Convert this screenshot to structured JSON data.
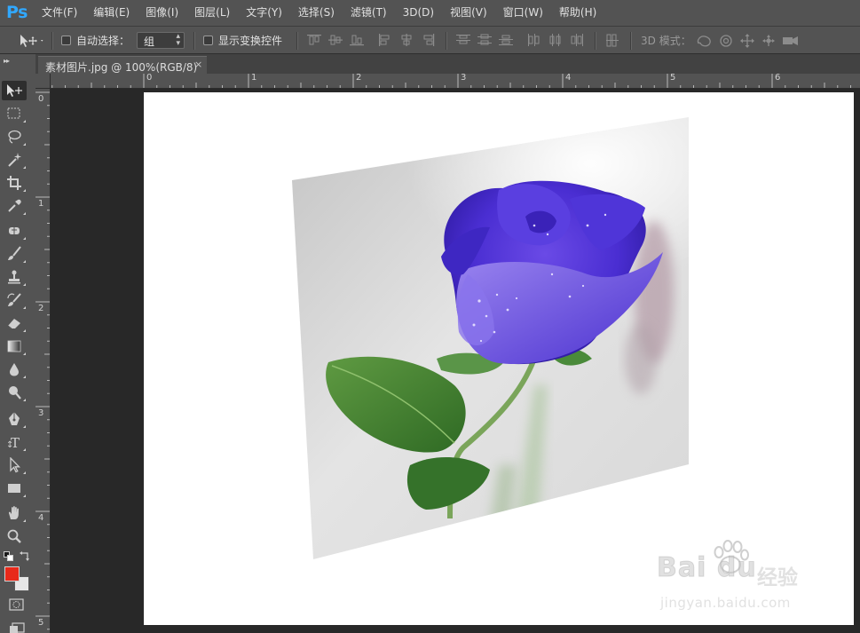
{
  "app": {
    "logo": "Ps"
  },
  "menu": [
    "文件(F)",
    "编辑(E)",
    "图像(I)",
    "图层(L)",
    "文字(Y)",
    "选择(S)",
    "滤镜(T)",
    "3D(D)",
    "视图(V)",
    "窗口(W)",
    "帮助(H)"
  ],
  "options": {
    "auto_select_label": "自动选择：",
    "auto_select_value": "组",
    "show_transform_label": "显示变换控件",
    "mode_3d_label": "3D 模式："
  },
  "document": {
    "tab_title": "素材图片.jpg @ 100%(RGB/8)",
    "close_glyph": "×"
  },
  "ruler": {
    "top_labels": [
      "0",
      "1",
      "2",
      "3",
      "4",
      "5",
      "6"
    ],
    "left_labels": [
      "0",
      "1",
      "2",
      "3",
      "4",
      "5"
    ]
  },
  "tools": [
    "move-tool",
    "marquee-tool",
    "lasso-tool",
    "magic-wand-tool",
    "crop-tool",
    "eyedropper-tool",
    "healing-brush-tool",
    "brush-tool",
    "clone-stamp-tool",
    "history-brush-tool",
    "eraser-tool",
    "gradient-tool",
    "blur-tool",
    "dodge-tool",
    "pen-tool",
    "type-tool",
    "path-selection-tool",
    "rectangle-tool",
    "hand-tool",
    "zoom-tool"
  ],
  "colors": {
    "foreground": "#e8291a",
    "background": "#e6e6e6",
    "ui_bar": "#535353",
    "pasteboard": "#282828",
    "accent_logo": "#31a8ff"
  },
  "watermark": {
    "logo_text": "Bai du",
    "cn_text": "经验",
    "url": "jingyan.baidu.com"
  }
}
